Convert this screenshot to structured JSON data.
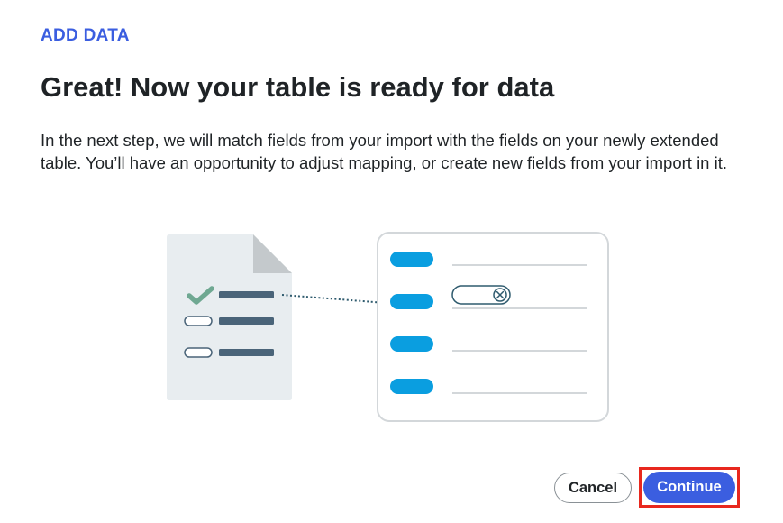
{
  "dialog": {
    "eyebrow": "ADD DATA",
    "title": "Great! Now your table is ready for data",
    "description": "In the next step, we will match fields from your import with the fields on your newly extended table. You’ll have an opportunity to adjust mapping, or create new fields from your import in it."
  },
  "illustration": {
    "icons": [
      "document-icon",
      "checkmark-icon",
      "mapping-table-icon",
      "remove-circle-icon"
    ]
  },
  "actions": {
    "cancel_label": "Cancel",
    "continue_label": "Continue"
  },
  "colors": {
    "accent": "#3b5ee0",
    "field_blue": "#0a9ee0",
    "check_green": "#6fa892",
    "highlight_red": "#e8281e"
  }
}
